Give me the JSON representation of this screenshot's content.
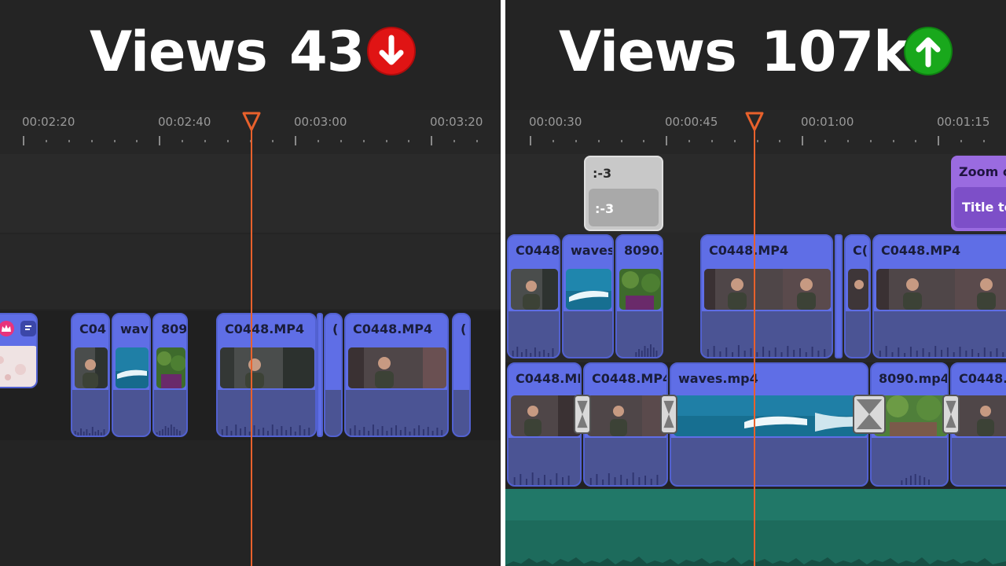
{
  "left": {
    "headline_word": "Views",
    "headline_count": "43",
    "trend_icon": "down-arrow-icon",
    "trend_color": "#e01414",
    "ruler_labels": [
      "00:02:20",
      "00:02:40",
      "00:03:00",
      "00:03:20"
    ],
    "clips": [
      "C04",
      "wav",
      "809",
      "C0448.MP4",
      "(",
      "C0448.MP4",
      "("
    ]
  },
  "right": {
    "headline_word": "Views",
    "headline_count": "107k",
    "trend_icon": "up-arrow-icon",
    "trend_color": "#19a81c",
    "ruler_labels": [
      "00:00:30",
      "00:00:45",
      "00:01:00",
      "00:01:15"
    ],
    "overlay_clip": {
      "top_label": ":-3",
      "inner_label": ":-3"
    },
    "zoom_clip": {
      "top_label": "Zoom c",
      "inner_label": "Title te"
    },
    "video_track_2_clips": [
      "C0448",
      "waves",
      "8090.",
      "C0448.MP4",
      "C(",
      "C0448.MP4"
    ],
    "video_track_1_clips": [
      "C0448.MI",
      "C0448.MP4",
      "waves.mp4",
      "8090.mp4",
      "C0448."
    ]
  },
  "colors": {
    "clip_fill": "#5f6ee6",
    "audio_fill": "#4b5494",
    "playhead": "#e8612c",
    "music_track": "#1d6b5c",
    "panel_bg": "#242424"
  }
}
